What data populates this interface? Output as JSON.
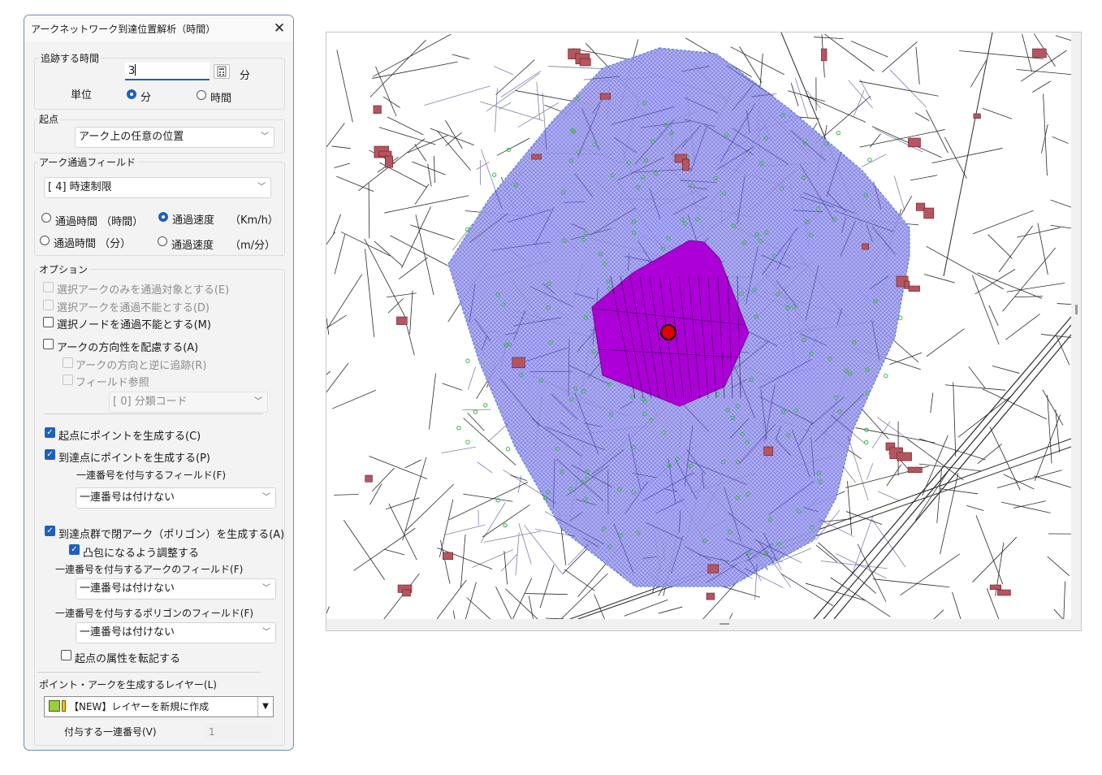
{
  "dialog": {
    "title": "アークネットワーク到達位置解析（時間）",
    "close_glyph": "✕",
    "trace": {
      "group_label": "追跡する時間",
      "value": "3",
      "unit_suffix": "分",
      "unit_label": "単位",
      "unit_minute": "分",
      "unit_hour": "時間",
      "selected_unit": "minute"
    },
    "origin": {
      "group_label": "起点",
      "selected": "アーク上の任意の位置"
    },
    "arc_field": {
      "group_label": "アーク通過フィールド",
      "selected": "[ 4] 時速制限",
      "opt_time_hours": "通過時間 （時間）",
      "opt_speed_kmh": "通過速度",
      "unit_kmh": "（Km/h）",
      "opt_time_minutes": "通過時間 （分）",
      "opt_speed_ms": "通過速度",
      "unit_ms": "（m/分）",
      "selected_option": "speed_kmh"
    },
    "options": {
      "group_label": "オプション",
      "selected_arcs_only": "選択アークのみを通過対象とする(E)",
      "selected_arcs_blocked": "選択アークを通過不能とする(D)",
      "selected_nodes_blocked": "選択ノードを通過不能とする(M)",
      "consider_direction": "アークの方向性を配慮する(A)",
      "reverse_trace": "アークの方向と逆に追跡(R)",
      "field_reference": "フィールド参照",
      "field_combo": "[ 0] 分類コード",
      "point_at_origin": "起点にポイントを生成する(C)",
      "point_at_destinations": "到達点にポイントを生成する(P)",
      "serial_field_label": "一連番号を付与するフィールド(F)",
      "serial_field_value": "一連番号は付けない",
      "polygon_from_destinations": "到達点群で閉アーク（ポリゴン）を生成する(A)",
      "convex_hull": "凸包になるよう調整する",
      "arc_serial_label": "一連番号を付与するアークのフィールド(F)",
      "arc_serial_value": "一連番号は付けない",
      "polygon_serial_label": "一連番号を付与するポリゴンのフィールド(F)",
      "polygon_serial_value": "一連番号は付けない",
      "copy_origin_attrs": "起点の属性を転記する"
    },
    "layer": {
      "label": "ポイント・アークを生成するレイヤー(L)",
      "value": "【NEW】レイヤーを新規に作成",
      "serial_label": "付与する一連番号(V)",
      "serial_value": "1"
    }
  },
  "colors": {
    "accent": "#1f5fbf",
    "outer_area": "#8c8ce8",
    "inner_area": "#b400e0",
    "origin_point": "#e00000",
    "road": "#2a2a2a",
    "building": "#b5555f",
    "reach_node": "#39b54a"
  },
  "map": {
    "outer_area_minutes": 3
  }
}
